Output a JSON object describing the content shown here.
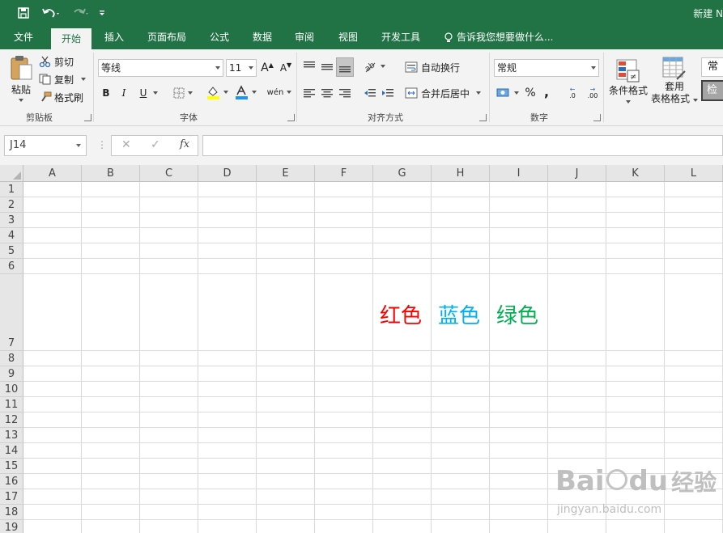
{
  "titlebar": {
    "doc_title": "新建 N",
    "colors": {
      "bg": "#217346"
    }
  },
  "tabs": [
    {
      "label": "文件"
    },
    {
      "label": "开始"
    },
    {
      "label": "插入"
    },
    {
      "label": "页面布局"
    },
    {
      "label": "公式"
    },
    {
      "label": "数据"
    },
    {
      "label": "审阅"
    },
    {
      "label": "视图"
    },
    {
      "label": "开发工具"
    }
  ],
  "tellme": {
    "label": "告诉我您想要做什么..."
  },
  "ribbon": {
    "clipboard": {
      "paste": "粘贴",
      "cut": "剪切",
      "copy": "复制",
      "format_painter": "格式刷",
      "label": "剪贴板"
    },
    "font": {
      "name": "等线",
      "size": "11",
      "grow": "A",
      "shrink": "A",
      "bold": "B",
      "italic": "I",
      "underline": "U",
      "phonetic": "wén",
      "label": "字体",
      "font_color": "#1e90ff",
      "fill_color": "#ffff00"
    },
    "alignment": {
      "wrap": "自动换行",
      "merge": "合并后居中",
      "label": "对齐方式"
    },
    "number": {
      "format": "常规",
      "percent": "%",
      "comma": ",",
      "inc_decimal": ".0",
      "dec_decimal": ".00",
      "label": "数字"
    },
    "styles": {
      "conditional": "条件格式",
      "table_line1": "套用",
      "table_line2": "表格格式",
      "style_normal": "常规",
      "style_check": "检查"
    }
  },
  "formula_bar": {
    "name_box": "J14",
    "cancel": "✕",
    "enter": "✓",
    "fx": "fx",
    "value": ""
  },
  "sheet": {
    "columns": [
      "A",
      "B",
      "C",
      "D",
      "E",
      "F",
      "G",
      "H",
      "I",
      "J",
      "K",
      "L"
    ],
    "rows": [
      "1",
      "2",
      "3",
      "4",
      "5",
      "6",
      "7",
      "8",
      "9",
      "10",
      "11",
      "12",
      "13",
      "14",
      "15",
      "16",
      "17",
      "18",
      "19"
    ],
    "cells": [
      {
        "ref": "G7",
        "text": "红色",
        "color": "#ff0000"
      },
      {
        "ref": "H7",
        "text": "蓝色",
        "color": "#00b0f0"
      },
      {
        "ref": "I7",
        "text": "绿色",
        "color": "#00b050"
      }
    ]
  },
  "watermark": {
    "brand": "Bai",
    "brand2": "du",
    "suffix": "经验",
    "url": "jingyan.baidu.com"
  }
}
